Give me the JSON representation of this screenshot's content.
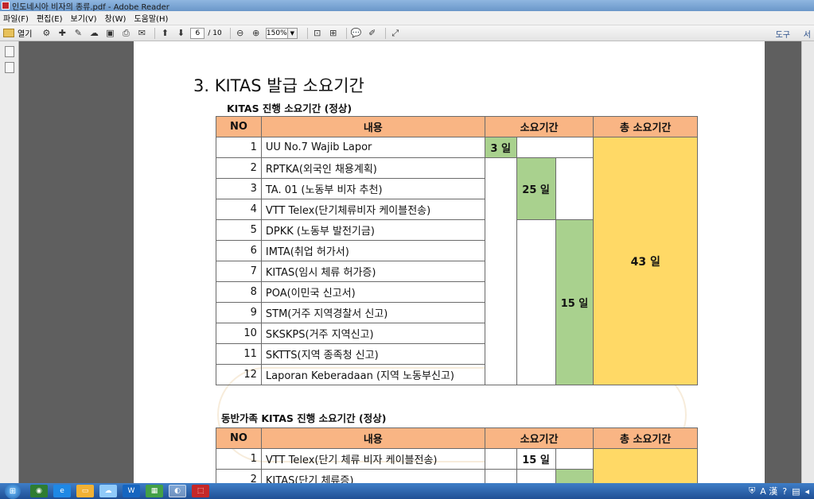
{
  "window": {
    "title": "인도네시아 비자의 종류.pdf - Adobe Reader"
  },
  "menu": [
    "파일(F)",
    "편집(E)",
    "보기(V)",
    "창(W)",
    "도움말(H)"
  ],
  "toolbar": {
    "open_label": "열기",
    "page_current": "6",
    "page_total": "/ 10",
    "zoom": "150%",
    "tools_label": "도구",
    "share_label": "서"
  },
  "document": {
    "heading": "3. KITAS 발급 소요기간",
    "section1": {
      "title": "KITAS 진행 소요기간 (정상)",
      "headers": [
        "NO",
        "내용",
        "소요기간",
        "총 소요기간"
      ],
      "rows": [
        {
          "no": "1",
          "desc": "UU No.7 Wajib Lapor"
        },
        {
          "no": "2",
          "desc": "RPTKA(외국인 채용계획)"
        },
        {
          "no": "3",
          "desc": "TA. 01 (노동부 비자 추천)"
        },
        {
          "no": "4",
          "desc": "VTT Telex(단기체류비자 케이블전송)"
        },
        {
          "no": "5",
          "desc": "DPKK (노동부 발전기금)"
        },
        {
          "no": "6",
          "desc": "IMTA(취업 허가서)"
        },
        {
          "no": "7",
          "desc": "KITAS(임시 체류 허가증)"
        },
        {
          "no": "8",
          "desc": "POA(이민국 신고서)"
        },
        {
          "no": "9",
          "desc": "STM(거주 지역경찰서 신고)"
        },
        {
          "no": "10",
          "desc": "SKSKPS(거주 지역신고)"
        },
        {
          "no": "11",
          "desc": "SKTTS(지역 종족청 신고)"
        },
        {
          "no": "12",
          "desc": "Laporan Keberadaan (지역 노동부신고)"
        }
      ],
      "period_a": "3 일",
      "period_b": "25 일",
      "period_c": "15 일",
      "total": "43 일"
    },
    "section2": {
      "title": "동반가족 KITAS 진행 소요기간 (정상)",
      "headers": [
        "NO",
        "내용",
        "소요기간",
        "총 소요기간"
      ],
      "rows": [
        {
          "no": "1",
          "desc": "VTT Telex(단기 체류 비자 케이블전송)"
        },
        {
          "no": "2",
          "desc": "KITAS(단기 체류증)"
        }
      ],
      "period_a": "15 일"
    }
  },
  "colors": {
    "header": "#f9b584",
    "green": "#a9d18e",
    "yellow": "#ffd966"
  },
  "taskbar": {
    "tray_lang": "A 漢"
  }
}
